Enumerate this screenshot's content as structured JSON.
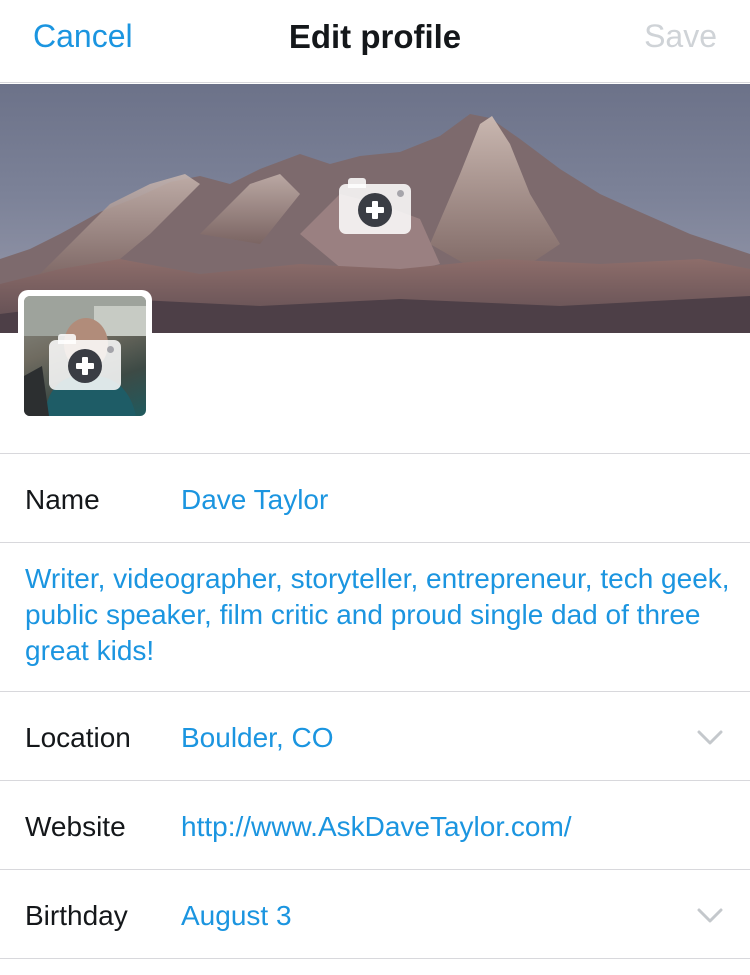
{
  "navbar": {
    "cancel_label": "Cancel",
    "title": "Edit profile",
    "save_label": "Save"
  },
  "icons": {
    "header_camera": "camera-plus-icon",
    "avatar_camera": "camera-plus-icon",
    "chevron": "chevron-down-icon"
  },
  "fields": {
    "name_label": "Name",
    "name_value": "Dave Taylor",
    "bio": "Writer, videographer, storyteller, entrepreneur, tech geek, public speaker, film critic and proud single dad of three great kids!",
    "location_label": "Location",
    "location_value": "Boulder, CO",
    "website_label": "Website",
    "website_value": "http://www.AskDaveTaylor.com/",
    "birthday_label": "Birthday",
    "birthday_value": "August 3"
  },
  "colors": {
    "accent": "#1b95e0",
    "disabled": "#cfd3d7",
    "text": "#14171a",
    "divider": "#d8d8dc"
  }
}
